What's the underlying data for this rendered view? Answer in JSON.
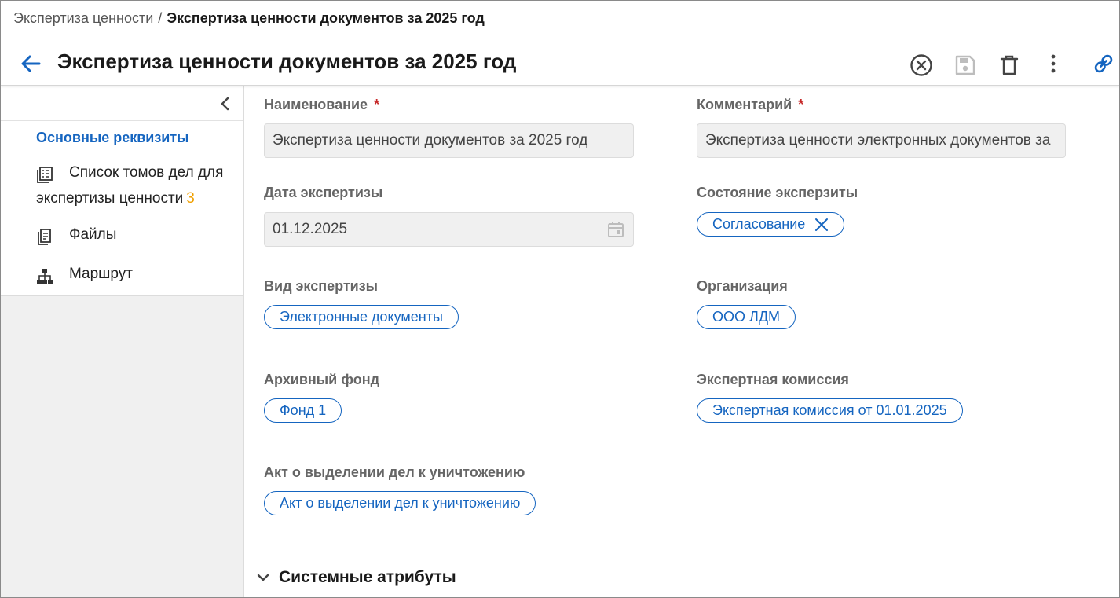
{
  "breadcrumb": {
    "parent": "Экспертиза ценности",
    "separator": "/",
    "current": "Экспертиза ценности документов за 2025 год"
  },
  "header": {
    "title": "Экспертиза ценности документов за 2025 год"
  },
  "sidebar": {
    "active_item": "Основные реквизиты",
    "items": [
      {
        "label_line1": "Список томов дел для",
        "label_line2": "экспертизы ценности",
        "count": "3",
        "icon": "list-icon"
      },
      {
        "label": "Файлы",
        "icon": "file-icon"
      },
      {
        "label": "Маршрут",
        "icon": "hierarchy-icon"
      }
    ]
  },
  "form": {
    "name": {
      "label": "Наименование",
      "required": "*",
      "value": "Экспертиза ценности документов за 2025 год"
    },
    "comment": {
      "label": "Комментарий",
      "required": "*",
      "value": "Экспертиза ценности электронных документов за"
    },
    "date": {
      "label": "Дата экспертизы",
      "value": "01.12.2025"
    },
    "state": {
      "label": "Состояние эксперзиты",
      "value": "Согласование"
    },
    "type": {
      "label": "Вид экспертизы",
      "value": "Электронные документы"
    },
    "org": {
      "label": "Организация",
      "value": "ООО ЛДМ"
    },
    "fund": {
      "label": "Архивный фонд",
      "value": "Фонд 1"
    },
    "commission": {
      "label": "Экспертная комиссия",
      "value": "Экспертная комиссия от 01.01.2025"
    },
    "act": {
      "label": "Акт о выделении дел к уничтожению",
      "value": "Акт о выделении дел к уничтожению"
    }
  },
  "section": {
    "system_attributes": "Системные атрибуты"
  },
  "colors": {
    "accent": "#1565c0",
    "required": "#c62828",
    "count": "#f0a000"
  }
}
